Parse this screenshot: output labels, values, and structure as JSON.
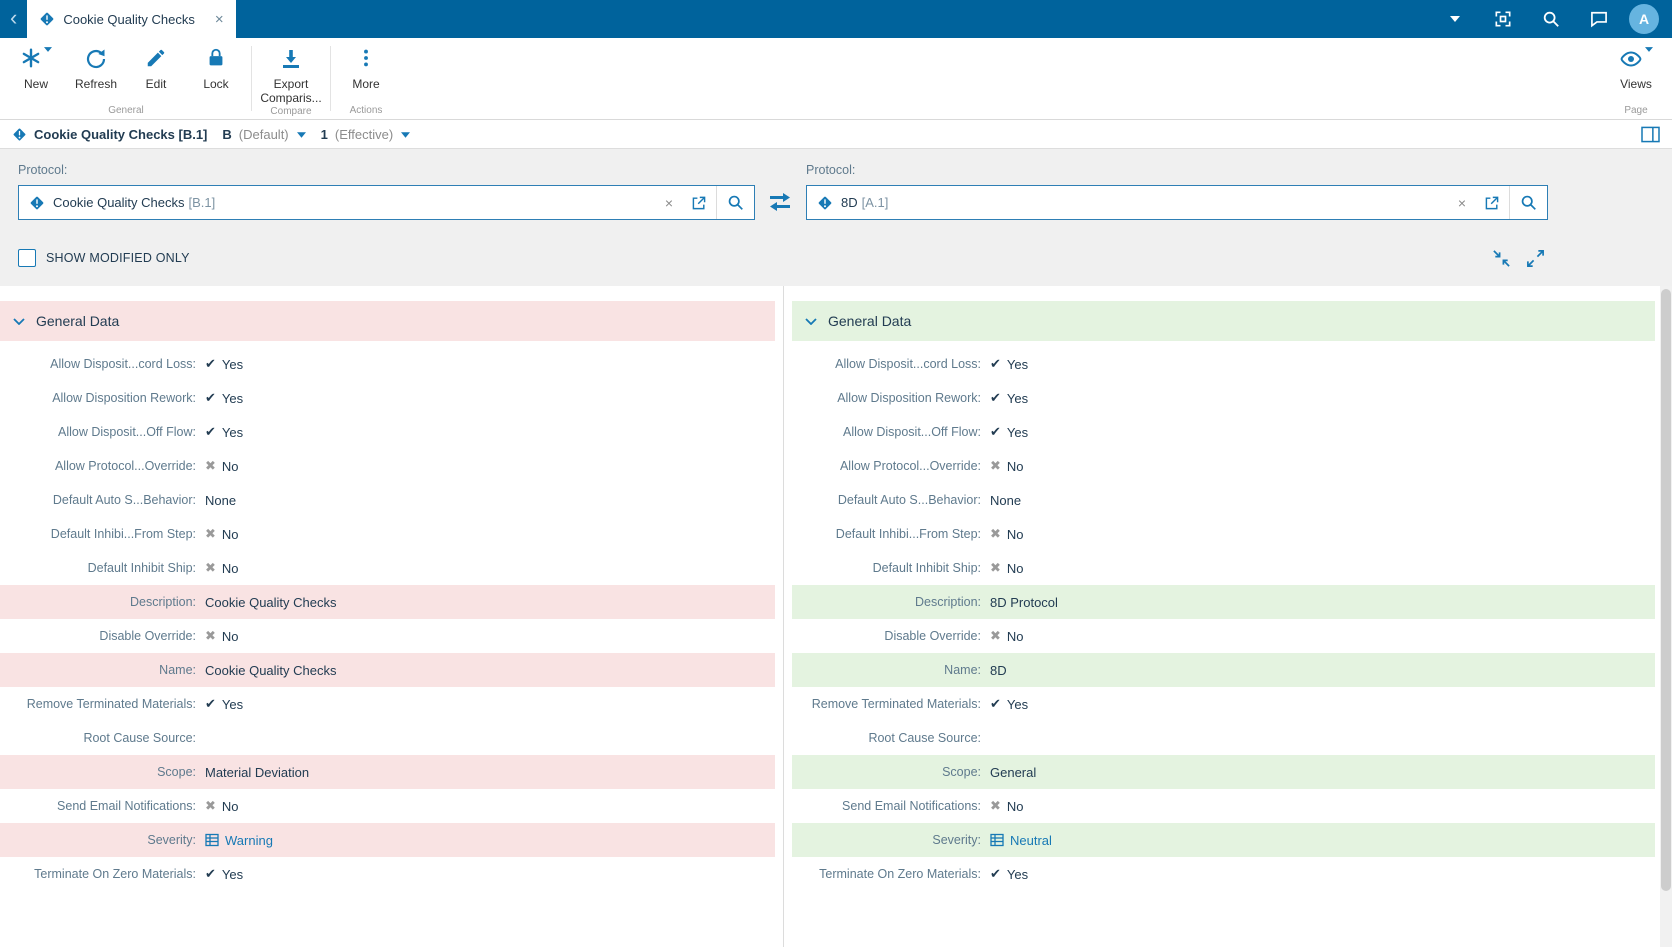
{
  "colors": {
    "titlebar": "#00639c",
    "accent": "#1779b5",
    "link": "#1779b5",
    "avatar": "#66b4e0",
    "modified_left": "#f9e3e3",
    "modified_right": "#e4f3e0"
  },
  "icons": {
    "back": "‹",
    "close": "×",
    "check": "✔",
    "cross": "✖"
  },
  "titlebar": {
    "tab_title": "Cookie Quality Checks",
    "avatar_initial": "A"
  },
  "toolbar": {
    "new": "New",
    "refresh": "Refresh",
    "edit": "Edit",
    "lock": "Lock",
    "export": "Export Comparis...",
    "more": "More",
    "views": "Views",
    "group_general": "General",
    "group_compare": "Compare",
    "group_actions": "Actions",
    "group_page": "Page"
  },
  "breadcrumb": {
    "title": "Cookie Quality Checks [B.1]",
    "revision": "B",
    "revision_state": "(Default)",
    "version": "1",
    "version_state": "(Effective)"
  },
  "filter": {
    "left_label": "Protocol:",
    "left_value": "Cookie Quality Checks",
    "left_version": "[B.1]",
    "right_label": "Protocol:",
    "right_value": "8D",
    "right_version": "[A.1]",
    "show_modified_label": "SHOW MODIFIED ONLY"
  },
  "columns": [
    {
      "side": "left",
      "section_title": "General Data",
      "rows": [
        {
          "label": "Allow Disposit...cord Loss:",
          "value": "Yes",
          "icon": "check",
          "modified": false
        },
        {
          "label": "Allow Disposition Rework:",
          "value": "Yes",
          "icon": "check",
          "modified": false
        },
        {
          "label": "Allow Disposit...Off Flow:",
          "value": "Yes",
          "icon": "check",
          "modified": false
        },
        {
          "label": "Allow Protocol...Override:",
          "value": "No",
          "icon": "cross",
          "modified": false
        },
        {
          "label": "Default Auto S...Behavior:",
          "value": "None",
          "icon": "none",
          "modified": false
        },
        {
          "label": "Default Inhibi...From Step:",
          "value": "No",
          "icon": "cross",
          "modified": false
        },
        {
          "label": "Default Inhibit Ship:",
          "value": "No",
          "icon": "cross",
          "modified": false
        },
        {
          "label": "Description:",
          "value": "Cookie Quality Checks",
          "icon": "none",
          "modified": true
        },
        {
          "label": "Disable Override:",
          "value": "No",
          "icon": "cross",
          "modified": false
        },
        {
          "label": "Name:",
          "value": "Cookie Quality Checks",
          "icon": "none",
          "modified": true
        },
        {
          "label": "Remove Terminated Materials:",
          "value": "Yes",
          "icon": "check",
          "modified": false
        },
        {
          "label": "Root Cause Source:",
          "value": "",
          "icon": "none",
          "modified": false
        },
        {
          "label": "Scope:",
          "value": "Material Deviation",
          "icon": "none",
          "modified": true
        },
        {
          "label": "Send Email Notifications:",
          "value": "No",
          "icon": "cross",
          "modified": false
        },
        {
          "label": "Severity:",
          "value": "Warning",
          "icon": "grid",
          "link": true,
          "modified": true
        },
        {
          "label": "Terminate On Zero Materials:",
          "value": "Yes",
          "icon": "check",
          "modified": false
        }
      ]
    },
    {
      "side": "right",
      "section_title": "General Data",
      "rows": [
        {
          "label": "Allow Disposit...cord Loss:",
          "value": "Yes",
          "icon": "check",
          "modified": false
        },
        {
          "label": "Allow Disposition Rework:",
          "value": "Yes",
          "icon": "check",
          "modified": false
        },
        {
          "label": "Allow Disposit...Off Flow:",
          "value": "Yes",
          "icon": "check",
          "modified": false
        },
        {
          "label": "Allow Protocol...Override:",
          "value": "No",
          "icon": "cross",
          "modified": false
        },
        {
          "label": "Default Auto S...Behavior:",
          "value": "None",
          "icon": "none",
          "modified": false
        },
        {
          "label": "Default Inhibi...From Step:",
          "value": "No",
          "icon": "cross",
          "modified": false
        },
        {
          "label": "Default Inhibit Ship:",
          "value": "No",
          "icon": "cross",
          "modified": false
        },
        {
          "label": "Description:",
          "value": "8D Protocol",
          "icon": "none",
          "modified": true
        },
        {
          "label": "Disable Override:",
          "value": "No",
          "icon": "cross",
          "modified": false
        },
        {
          "label": "Name:",
          "value": "8D",
          "icon": "none",
          "modified": true
        },
        {
          "label": "Remove Terminated Materials:",
          "value": "Yes",
          "icon": "check",
          "modified": false
        },
        {
          "label": "Root Cause Source:",
          "value": "",
          "icon": "none",
          "modified": false
        },
        {
          "label": "Scope:",
          "value": "General",
          "icon": "none",
          "modified": true
        },
        {
          "label": "Send Email Notifications:",
          "value": "No",
          "icon": "cross",
          "modified": false
        },
        {
          "label": "Severity:",
          "value": "Neutral",
          "icon": "grid",
          "link": true,
          "modified": true
        },
        {
          "label": "Terminate On Zero Materials:",
          "value": "Yes",
          "icon": "check",
          "modified": false
        }
      ]
    }
  ]
}
